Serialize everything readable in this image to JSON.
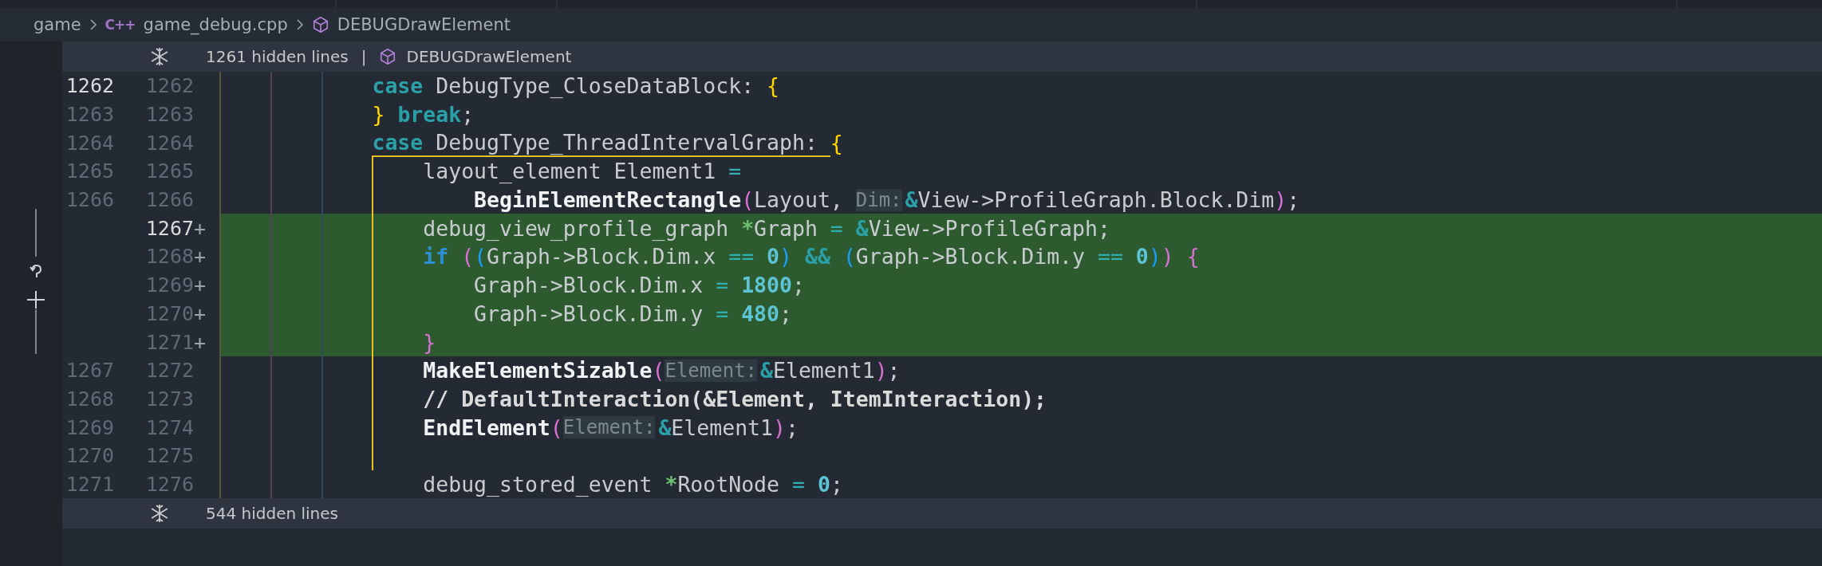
{
  "breadcrumb": [
    {
      "kind": "folder",
      "label": "game"
    },
    {
      "kind": "file",
      "icon": "C++",
      "label": "game_debug.cpp"
    },
    {
      "kind": "symbol",
      "label": "DEBUGDrawElement"
    }
  ],
  "hidden_top": {
    "label": "1261 hidden lines",
    "separator": "|",
    "symbol": "DEBUGDrawElement"
  },
  "lines": [
    {
      "old": {
        "number": "1262",
        "active": true
      },
      "new": {
        "number": "1262",
        "active": false
      },
      "added": false,
      "guide": false,
      "scope_start": false,
      "tokens": [
        {
          "kind": "keyword",
          "text": "            case"
        },
        {
          "kind": "plain",
          "text": " DebugType_CloseDataBlock: "
        },
        {
          "kind": "bracket",
          "color": "#ffd700",
          "text": "{"
        }
      ]
    },
    {
      "old": {
        "number": "1263",
        "active": false
      },
      "new": {
        "number": "1263",
        "active": false
      },
      "added": false,
      "guide": false,
      "scope_start": false,
      "tokens": [
        {
          "kind": "bracket",
          "color": "#ffd700",
          "text": "            }"
        },
        {
          "kind": "keyword",
          "text": " break"
        },
        {
          "kind": "plain",
          "text": ";"
        }
      ]
    },
    {
      "old": {
        "number": "1264",
        "active": false
      },
      "new": {
        "number": "1264",
        "active": false
      },
      "added": false,
      "guide": false,
      "scope_start": true,
      "tokens": [
        {
          "kind": "keyword",
          "text": "            case"
        },
        {
          "kind": "plain",
          "text": " DebugType_ThreadIntervalGraph: "
        },
        {
          "kind": "bracket",
          "color": "#ffd700",
          "text": "{"
        }
      ]
    },
    {
      "old": {
        "number": "1265",
        "active": false
      },
      "new": {
        "number": "1265",
        "active": false
      },
      "added": false,
      "guide": true,
      "scope_start": false,
      "tokens": [
        {
          "kind": "plain",
          "text": "                layout_element Element1 "
        },
        {
          "kind": "operator",
          "text": "="
        }
      ]
    },
    {
      "old": {
        "number": "1266",
        "active": false
      },
      "new": {
        "number": "1266",
        "active": false
      },
      "added": false,
      "guide": true,
      "scope_start": false,
      "tokens": [
        {
          "kind": "func",
          "text": "                    BeginElementRectangle"
        },
        {
          "kind": "bracket",
          "color": "#da70d6",
          "text": "("
        },
        {
          "kind": "plain",
          "text": "Layout, "
        },
        {
          "kind": "hint",
          "text": "Dim:"
        },
        {
          "kind": "keyword",
          "text": "&"
        },
        {
          "kind": "plain",
          "text": "View->ProfileGraph.Block.Dim"
        },
        {
          "kind": "bracket",
          "color": "#da70d6",
          "text": ")"
        },
        {
          "kind": "plain",
          "text": ";"
        }
      ]
    },
    {
      "new": {
        "number": "1267",
        "active": true
      },
      "plus": "+",
      "added": true,
      "guide": true,
      "scope_start": false,
      "tokens": [
        {
          "kind": "plain",
          "text": "                debug_view_profile_graph "
        },
        {
          "kind": "pointer",
          "text": "*"
        },
        {
          "kind": "plain",
          "text": "Graph "
        },
        {
          "kind": "operator",
          "text": "= "
        },
        {
          "kind": "keyword",
          "text": "&"
        },
        {
          "kind": "plain",
          "text": "View->ProfileGraph;"
        }
      ]
    },
    {
      "new": {
        "number": "1268",
        "active": false
      },
      "plus": "+",
      "added": true,
      "guide": true,
      "scope_start": false,
      "tokens": [
        {
          "kind": "control",
          "text": "                if"
        },
        {
          "kind": "bracket",
          "color": "#da70d6",
          "text": " ("
        },
        {
          "kind": "bracket",
          "color": "#179fff",
          "text": "("
        },
        {
          "kind": "plain",
          "text": "Graph->Block.Dim.x "
        },
        {
          "kind": "operator",
          "text": "== "
        },
        {
          "kind": "number",
          "text": "0"
        },
        {
          "kind": "bracket",
          "color": "#179fff",
          "text": ")"
        },
        {
          "kind": "keyword",
          "text": " && "
        },
        {
          "kind": "bracket",
          "color": "#179fff",
          "text": "("
        },
        {
          "kind": "plain",
          "text": "Graph->Block.Dim.y "
        },
        {
          "kind": "operator",
          "text": "== "
        },
        {
          "kind": "number",
          "text": "0"
        },
        {
          "kind": "bracket",
          "color": "#179fff",
          "text": ")"
        },
        {
          "kind": "bracket",
          "color": "#da70d6",
          "text": ")"
        },
        {
          "kind": "bracket",
          "color": "#da70d6",
          "text": " {"
        }
      ]
    },
    {
      "new": {
        "number": "1269",
        "active": false
      },
      "plus": "+",
      "added": true,
      "guide": true,
      "scope_start": false,
      "tokens": [
        {
          "kind": "plain",
          "text": "                    Graph->Block.Dim.x "
        },
        {
          "kind": "operator",
          "text": "= "
        },
        {
          "kind": "number",
          "text": "1800"
        },
        {
          "kind": "plain",
          "text": ";"
        }
      ]
    },
    {
      "new": {
        "number": "1270",
        "active": false
      },
      "plus": "+",
      "added": true,
      "guide": true,
      "scope_start": false,
      "tokens": [
        {
          "kind": "plain",
          "text": "                    Graph->Block.Dim.y "
        },
        {
          "kind": "operator",
          "text": "= "
        },
        {
          "kind": "number",
          "text": "480"
        },
        {
          "kind": "plain",
          "text": ";"
        }
      ]
    },
    {
      "new": {
        "number": "1271",
        "active": false
      },
      "plus": "+",
      "added": true,
      "guide": true,
      "scope_start": false,
      "tokens": [
        {
          "kind": "bracket",
          "color": "#da70d6",
          "text": "                }"
        }
      ]
    },
    {
      "old": {
        "number": "1267",
        "active": false
      },
      "new": {
        "number": "1272",
        "active": false
      },
      "added": false,
      "guide": true,
      "scope_start": false,
      "tokens": [
        {
          "kind": "func",
          "text": "                MakeElementSizable"
        },
        {
          "kind": "bracket",
          "color": "#da70d6",
          "text": "("
        },
        {
          "kind": "hint",
          "text": "Element:"
        },
        {
          "kind": "keyword",
          "text": "&"
        },
        {
          "kind": "plain",
          "text": "Element1"
        },
        {
          "kind": "bracket",
          "color": "#da70d6",
          "text": ")"
        },
        {
          "kind": "plain",
          "text": ";"
        }
      ]
    },
    {
      "old": {
        "number": "1268",
        "active": false
      },
      "new": {
        "number": "1273",
        "active": false
      },
      "added": false,
      "guide": true,
      "scope_start": false,
      "tokens": [
        {
          "kind": "comment",
          "text": "                // DefaultInteraction(&Element, ItemInteraction);"
        }
      ]
    },
    {
      "old": {
        "number": "1269",
        "active": false
      },
      "new": {
        "number": "1274",
        "active": false
      },
      "added": false,
      "guide": true,
      "scope_start": false,
      "tokens": [
        {
          "kind": "func",
          "text": "                EndElement"
        },
        {
          "kind": "bracket",
          "color": "#da70d6",
          "text": "("
        },
        {
          "kind": "hint",
          "text": "Element:"
        },
        {
          "kind": "keyword",
          "text": "&"
        },
        {
          "kind": "plain",
          "text": "Element1"
        },
        {
          "kind": "bracket",
          "color": "#da70d6",
          "text": ")"
        },
        {
          "kind": "plain",
          "text": ";"
        }
      ]
    },
    {
      "old": {
        "number": "1270",
        "active": false
      },
      "new": {
        "number": "1275",
        "active": false
      },
      "added": false,
      "guide": true,
      "scope_start": false
    },
    {
      "old": {
        "number": "1271",
        "active": false
      },
      "new": {
        "number": "1276",
        "active": false
      },
      "added": false,
      "guide": false,
      "scope_start": false,
      "tokens": [
        {
          "kind": "plain",
          "text": "                debug_stored_event "
        },
        {
          "kind": "pointer",
          "text": "*"
        },
        {
          "kind": "plain",
          "text": "RootNode "
        },
        {
          "kind": "operator",
          "text": "= "
        },
        {
          "kind": "number",
          "text": "0"
        },
        {
          "kind": "plain",
          "text": ";"
        }
      ]
    }
  ],
  "hidden_bottom": {
    "label": "544 hidden lines"
  }
}
